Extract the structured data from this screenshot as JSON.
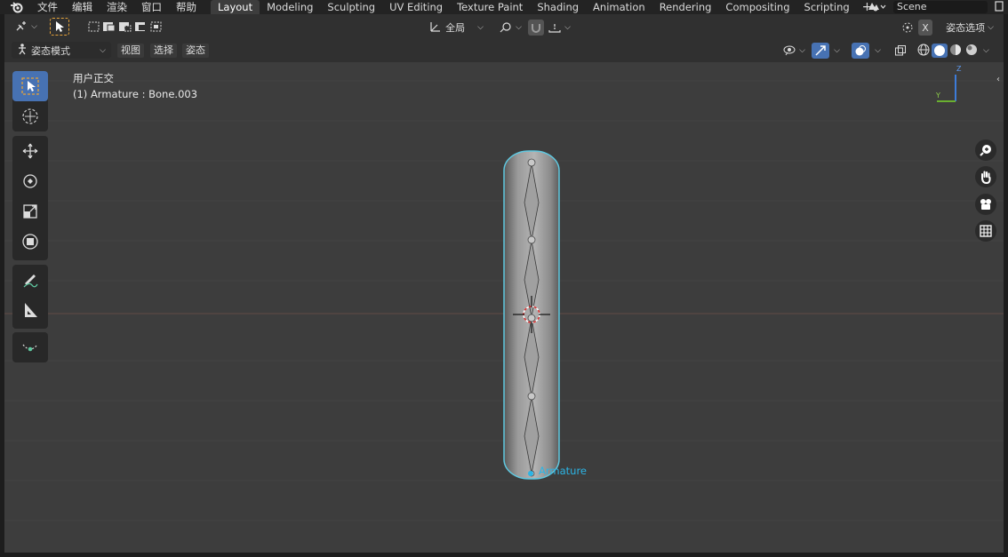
{
  "topbar": {
    "menus": [
      "文件",
      "编辑",
      "渲染",
      "窗口",
      "帮助"
    ],
    "workspaces": [
      "Layout",
      "Modeling",
      "Sculpting",
      "UV Editing",
      "Texture Paint",
      "Shading",
      "Animation",
      "Rendering",
      "Compositing",
      "Scripting"
    ],
    "active_workspace": "Layout",
    "add_label": "+",
    "scene_name": "Scene"
  },
  "header": {
    "transform_orientation": "全局",
    "close_label": "X",
    "pose_options_label": "姿态选项",
    "mode_label": "姿态模式",
    "menus": [
      "视图",
      "选择",
      "姿态"
    ]
  },
  "viewport": {
    "view_name": "用户正交",
    "object_info": "(1) Armature : Bone.003",
    "armature_label": "Armature",
    "gizmo_axes": [
      "Y",
      "Z"
    ],
    "colors": {
      "background": "#3d3d3d",
      "selection_outline": "#5fc8e0",
      "active_tool": "#4772b3",
      "armature_label": "#2bb5e6"
    }
  },
  "toolbar": {
    "tools": [
      "select-box-tool",
      "cursor-tool",
      "move-tool",
      "rotate-tool",
      "scale-tool",
      "transform-tool",
      "annotate-tool",
      "measure-tool",
      "breakdowner-tool"
    ]
  }
}
